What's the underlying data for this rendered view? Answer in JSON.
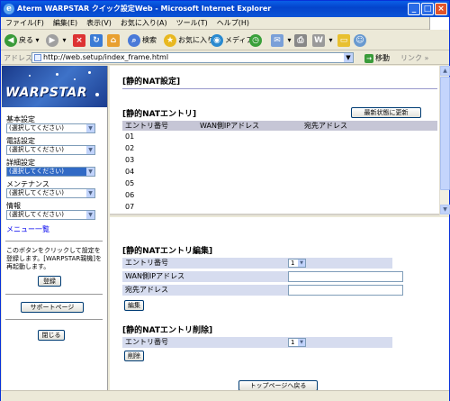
{
  "window": {
    "title": "Aterm WARPSTAR クイック設定Web - Microsoft Internet Explorer",
    "minimize": "_",
    "maximize": "□",
    "close": "×"
  },
  "menubar": [
    "ファイル(F)",
    "編集(E)",
    "表示(V)",
    "お気に入り(A)",
    "ツール(T)",
    "ヘルプ(H)"
  ],
  "toolbar": {
    "back": "戻る",
    "search": "検索",
    "favorites": "お気に入り",
    "media": "メディア"
  },
  "address": {
    "label": "アドレス(D)",
    "url": "http://web.setup/index_frame.html",
    "go": "移動",
    "links": "リンク"
  },
  "sidebar": {
    "logo": "WARPSTAR",
    "groups": [
      {
        "label": "基本設定",
        "value": "(選択してください)"
      },
      {
        "label": "電話設定",
        "value": "(選択してください)"
      },
      {
        "label": "詳細設定",
        "value": "(選択してください)",
        "highlighted": true
      },
      {
        "label": "メンテナンス",
        "value": "(選択してください)"
      },
      {
        "label": "情報",
        "value": "(選択してください)"
      }
    ],
    "menu_list": "メニュー一覧",
    "note": "このボタンをクリックして設定を登録します。[WARPSTAR親機]を再起動します。",
    "register": "登録",
    "support": "サポートページ",
    "close": "閉じる"
  },
  "top_frame": {
    "page_title": "[静的NAT設定]",
    "section_title": "[静的NATエントリ]",
    "refresh": "最新状態に更新",
    "columns": [
      "エントリ番号",
      "WAN側IPアドレス",
      "宛先アドレス"
    ],
    "entries": [
      "01",
      "02",
      "03",
      "04",
      "05",
      "06",
      "07"
    ]
  },
  "bottom_frame": {
    "edit_title": "[静的NATエントリ編集]",
    "entry_label": "エントリ番号",
    "entry_value": "1",
    "wan_label": "WAN側IPアドレス",
    "dest_label": "宛先アドレス",
    "edit_button": "編集",
    "delete_title": "[静的NATエントリ削除]",
    "delete_entry_label": "エントリ番号",
    "delete_entry_value": "1",
    "delete_button": "削除",
    "top_page_button": "トップページへ戻る"
  },
  "colors": {
    "title_bar": "#0a5fe7",
    "table_header": "#c6c6d6",
    "field_row": "#d6dcef",
    "highlight": "#316ac5"
  }
}
